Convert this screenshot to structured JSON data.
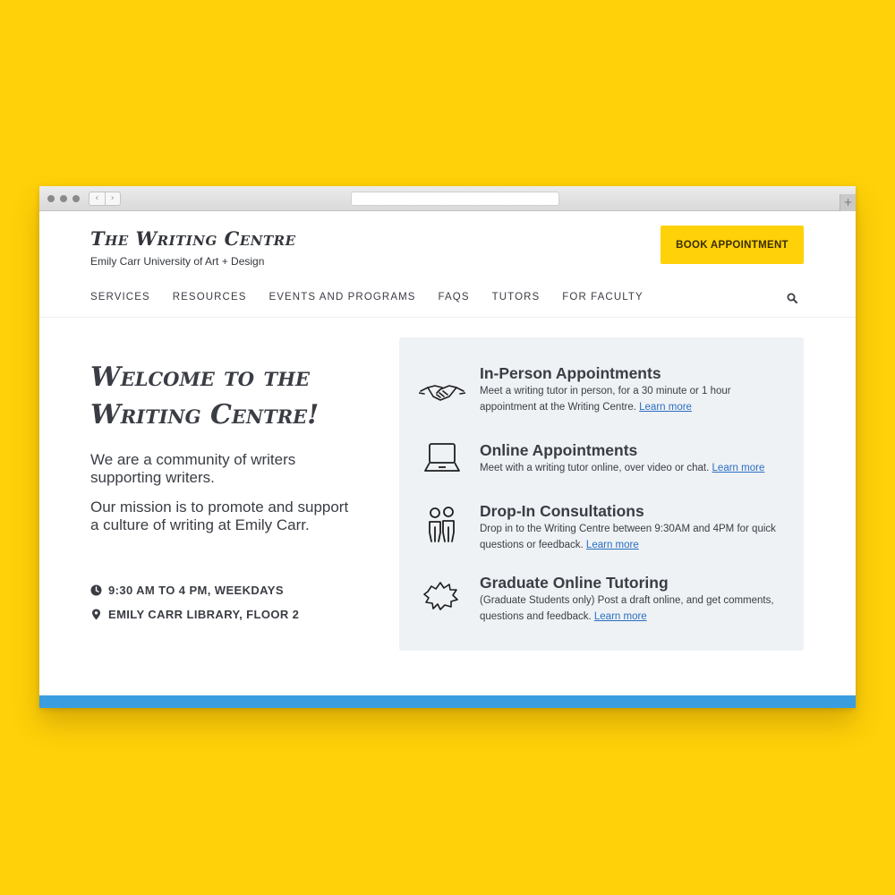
{
  "site": {
    "title": "The Writing Centre",
    "subtitle": "Emily Carr University of Art + Design",
    "book_button": "BOOK APPOINTMENT"
  },
  "nav": {
    "items": [
      "SERVICES",
      "RESOURCES",
      "EVENTS AND PROGRAMS",
      "FAQS",
      "TUTORS",
      "FOR FACULTY"
    ],
    "search_icon": "search-icon"
  },
  "hero": {
    "heading": "Welcome to the Writing Centre!",
    "intro": "We are a community of writers supporting writers.",
    "mission": "Our mission is to promote and support a culture of writing at Emily Carr.",
    "hours": "9:30 AM TO 4 PM, WEEKDAYS",
    "location": "EMILY CARR LIBRARY, FLOOR 2"
  },
  "services": [
    {
      "icon": "handshake-icon",
      "title": "In-Person Appointments",
      "description": "Meet a writing tutor in person, for a 30 minute or 1 hour appointment at the Writing Centre.",
      "link": "Learn more"
    },
    {
      "icon": "laptop-icon",
      "title": "Online Appointments",
      "description": "Meet with a writing tutor online, over video or chat.",
      "link": "Learn more"
    },
    {
      "icon": "people-icon",
      "title": "Drop-In Consultations",
      "description": "Drop in to the Writing Centre between 9:30AM and 4PM for quick questions or feedback.",
      "link": "Learn more"
    },
    {
      "icon": "speech-bubble-icon",
      "title": "Graduate Online Tutoring",
      "description": "(Graduate Students only) Post a draft online, and get comments, questions and feedback.",
      "link": "Learn more"
    }
  ],
  "colors": {
    "background": "#FFD108",
    "button": "#FFD108",
    "panel": "#eff2f5",
    "link": "#2a6fc0",
    "footer_bar": "#3a9de0"
  }
}
